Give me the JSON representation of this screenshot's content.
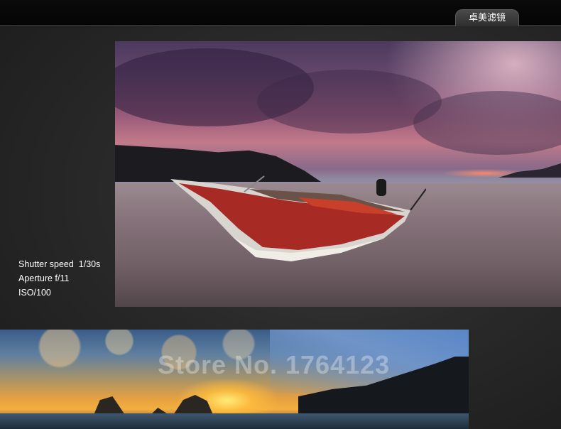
{
  "header": {
    "tab_label": "卓美滤镜"
  },
  "exif": {
    "shutter": "Shutter speed  1/30s",
    "aperture": "Aperture f/11",
    "iso": "ISO/100"
  },
  "watermark": {
    "text": "Store No. 1764123"
  }
}
